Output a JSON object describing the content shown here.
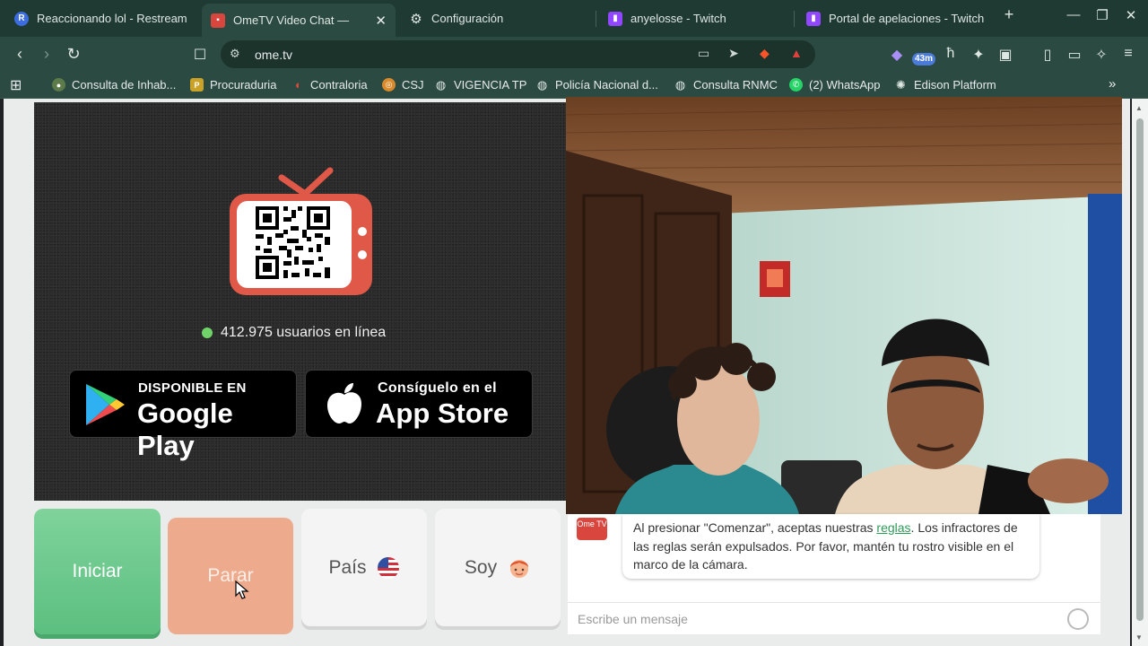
{
  "browser": {
    "tabs": [
      {
        "title": "Reaccionando lol - Restream",
        "favicon": "restream-icon",
        "color": "#3b6ce0"
      },
      {
        "title": "OmeTV Video Chat —",
        "favicon": "ometv-icon",
        "color": "#d9463e",
        "active": true
      },
      {
        "title": "Configuración",
        "favicon": "gear-icon"
      },
      {
        "title": "anyelosse - Twitch",
        "favicon": "twitch-icon",
        "color": "#9146ff"
      },
      {
        "title": "Portal de apelaciones - Twitch",
        "favicon": "twitch-icon",
        "color": "#9146ff"
      }
    ],
    "url": "ome.tv",
    "extension_badge": "43m",
    "bookmarks": [
      {
        "label": "Consulta de Inhab...",
        "icon": "seal-icon"
      },
      {
        "label": "Procuraduria",
        "icon": "procuraduria-icon"
      },
      {
        "label": "Contraloria",
        "icon": "contraloria-icon"
      },
      {
        "label": "CSJ",
        "icon": "csj-icon"
      },
      {
        "label": "VIGENCIA TP",
        "icon": "globe-icon"
      },
      {
        "label": "Policía Nacional d...",
        "icon": "globe-icon"
      },
      {
        "label": "Consulta RNMC",
        "icon": "globe-icon"
      },
      {
        "label": "(2) WhatsApp",
        "icon": "whatsapp-icon"
      },
      {
        "label": "Edison Platform",
        "icon": "edison-icon"
      }
    ]
  },
  "page": {
    "online_count_text": "412.975 usuarios en línea",
    "google_play": {
      "small": "DISPONIBLE EN",
      "big": "Google Play"
    },
    "app_store": {
      "small": "Consíguelo en el",
      "big": "App Store"
    },
    "buttons": {
      "start": "Iniciar",
      "stop": "Parar",
      "country": "País",
      "iam": "Soy"
    },
    "chat": {
      "logo_text": "Ome TV",
      "message_before": "Al presionar \"Comenzar\", aceptas nuestras ",
      "rules_link": "reglas",
      "message_after": ". Los infractores de las reglas serán expulsados. Por favor, mantén tu rostro visible en el marco de la cámara.",
      "input_placeholder": "Escribe un mensaje"
    }
  },
  "colors": {
    "tabstrip": "#1f3a32",
    "toolbar": "#2b4a41",
    "start_button": "#6fcb8d",
    "stop_button": "#eeaa8c",
    "brand_red": "#d9463e"
  }
}
